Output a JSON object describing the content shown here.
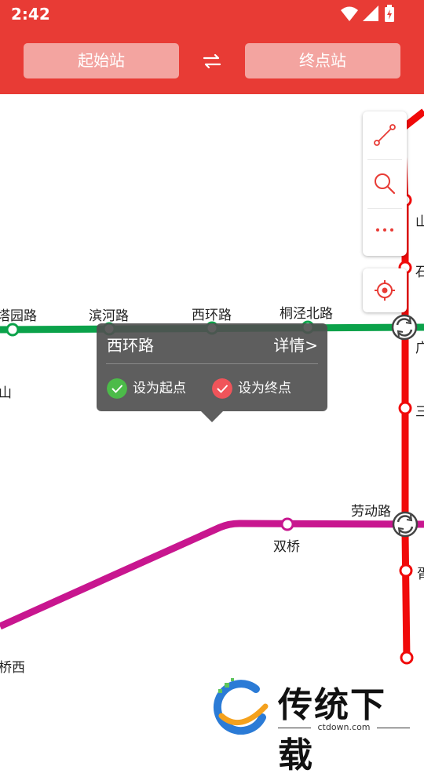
{
  "status_bar": {
    "time": "2:42"
  },
  "header": {
    "start_station_label": "起始站",
    "end_station_label": "终点站"
  },
  "map": {
    "stations": {
      "tayuan_road": "塔园路",
      "binhe_road": "滨河路",
      "xihuan_road": "西环路",
      "tongjing_north_road": "桐泾北路",
      "shan_left": "山",
      "laodong_road": "劳动路",
      "shuangqiao": "双桥",
      "qiao_xi": "桥西",
      "right_1": "山",
      "right_2": "石",
      "right_3": "广",
      "right_4": "三",
      "right_5": "胥"
    },
    "colors": {
      "line_red": "#f00a0a",
      "line_green": "#0ba24a",
      "line_magenta": "#c8168f"
    }
  },
  "popup": {
    "station_name": "西环路",
    "detail_label": "详情>",
    "set_start_label": "设为起点",
    "set_end_label": "设为终点"
  },
  "watermark": {
    "text": "传统下载",
    "url": "ctdown.com"
  }
}
